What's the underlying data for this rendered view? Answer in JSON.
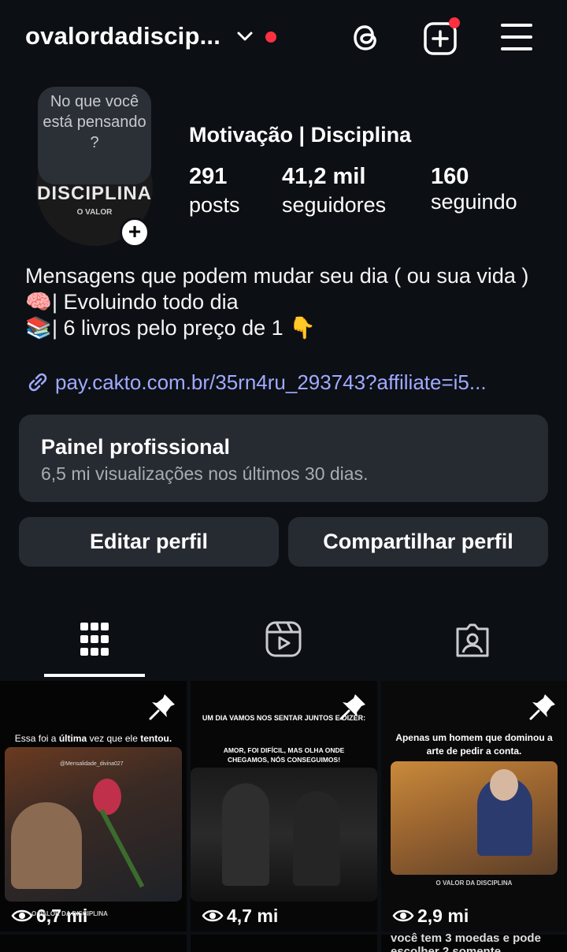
{
  "header": {
    "username": "ovalordadiscip...",
    "icons": [
      "chevron-down-icon",
      "threads-icon",
      "create-post-icon",
      "menu-icon"
    ]
  },
  "profile": {
    "note_bubble": "No que você está pensando ?",
    "avatar_text_big": "DISCIPLINA",
    "avatar_text_small": "O VALOR",
    "display_name": "Motivação | Disciplina",
    "stats": {
      "posts_count": "291",
      "posts_label": "posts",
      "followers_count": "41,2 mil",
      "followers_label": "seguidores",
      "following_count": "160",
      "following_label": "seguindo"
    }
  },
  "bio": {
    "line1": "Mensagens que podem mudar seu dia ( ou sua vida )",
    "line2_emoji": "🧠",
    "line2": "| Evoluindo todo dia",
    "line3_emoji": "📚",
    "line3": "| 6 livros pelo preço de 1 👇",
    "link": "pay.cakto.com.br/35rn4ru_293743?affiliate=i5..."
  },
  "dashboard": {
    "title": "Painel profissional",
    "subtitle": "6,5 mi visualizações nos últimos 30 dias."
  },
  "actions": {
    "edit_label": "Editar perfil",
    "share_label": "Compartilhar perfil"
  },
  "tabs": [
    "grid-icon",
    "reels-icon",
    "tagged-icon"
  ],
  "posts": [
    {
      "caption_a": "Essa foi a ",
      "caption_b": "última",
      "caption_c": " vez que ele ",
      "caption_d": "tentou.",
      "photo_tag": "@Mensalidade_divina027",
      "views": "6,7 mi",
      "footer": "O VALOR DA DISCIPLINA"
    },
    {
      "caption_top": "UM DIA VAMOS NOS SENTAR JUNTOS E DIZER:",
      "caption_body": "AMOR, FOI DIFÍCIL, MAS OLHA ONDE CHEGAMOS, NÓS CONSEGUIMOS!",
      "views": "4,7 mi"
    },
    {
      "caption": "Apenas um homem que dominou a arte de pedir a conta.",
      "footer": "O VALOR DA DISCIPLINA",
      "views": "2,9 mi"
    }
  ],
  "row2_partial_text": "você tem 3 moedas e pode escolher 2 somente.",
  "colors": {
    "background": "#0c0f14",
    "card": "#262a31",
    "link": "#a0aaff",
    "notification": "#ff3040"
  }
}
